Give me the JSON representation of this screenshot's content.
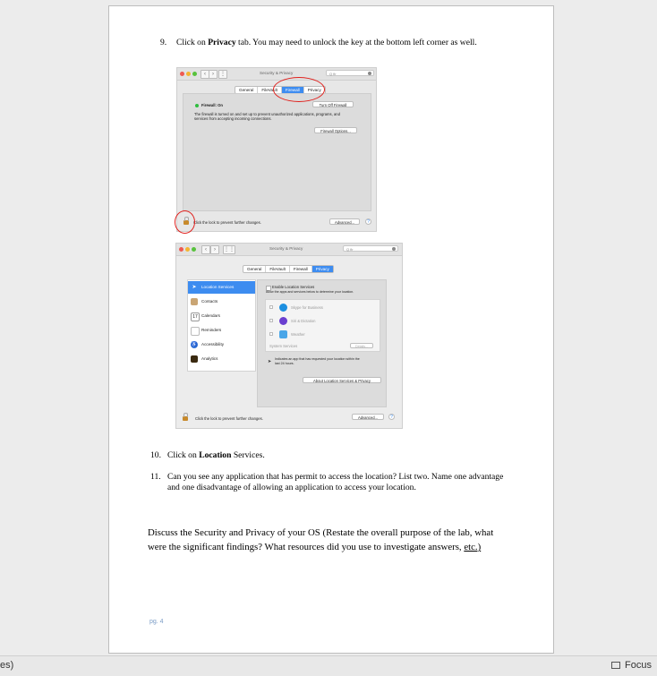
{
  "document": {
    "step9": {
      "num": "9.",
      "pre": "Click on ",
      "bold": "Privacy",
      "post": " tab. You may need to unlock the key at the bottom left corner as well."
    },
    "step10": {
      "num": "10.",
      "pre": "Click on ",
      "bold": "Location",
      "post": " Services."
    },
    "step11": {
      "num": "11.",
      "line1": "Can you see any application that has permit to access the location? List two. Name one advantage",
      "line2": "and one disadvantage of allowing an application to access your location."
    },
    "discussion": {
      "line1": "Discuss the Security and Privacy of your OS (Restate the overall purpose of the lab, what",
      "line2_pre": "were the significant findings? What resources did you use to investigate answers, ",
      "line2_link": "etc.)"
    },
    "footer": "pg. 4"
  },
  "screenshot1": {
    "title": "Security & Privacy",
    "search": "Q fir",
    "tabs": [
      "General",
      "FileVault",
      "Firewall",
      "Privacy"
    ],
    "active_tab": "Firewall",
    "firewall_status": "Firewall: On",
    "turn_off_button": "Turn Off Firewall",
    "description": [
      "The firewall is turned on and set up to prevent unauthorized applications, programs, and",
      "services from accepting incoming connections."
    ],
    "options_button": "Firewall Options...",
    "lock_text": "Click the lock to prevent further changes.",
    "advanced_button": "Advanced...",
    "help": "?"
  },
  "screenshot2": {
    "title": "Security & Privacy",
    "search": "Q fir",
    "tabs": [
      "General",
      "FileVault",
      "Firewall",
      "Privacy"
    ],
    "active_tab": "Privacy",
    "sidebar": [
      "Location Services",
      "Contacts",
      "Calendars",
      "Reminders",
      "Accessibility",
      "Analytics"
    ],
    "enable_label": "Enable Location Services",
    "enable_sub": "Allow the apps and services below to determine your location.",
    "apps": [
      "Skype for Business",
      "Siri & Dictation",
      "Weather"
    ],
    "system_services": "System Services",
    "details_button": "Details...",
    "note": [
      "Indicates an app that has requested your location within the",
      "last 24 hours."
    ],
    "about_button": "About Location Services & Privacy",
    "lock_text": "Click the lock to prevent further changes.",
    "advanced_button": "Advanced...",
    "help": "?"
  },
  "statusbar": {
    "left_text": "es)",
    "focus_label": "Focus"
  },
  "colors": {
    "accent": "#3d8cf0",
    "annotation_red": "#e0201c",
    "footer_blue": "#7a9cc6"
  }
}
